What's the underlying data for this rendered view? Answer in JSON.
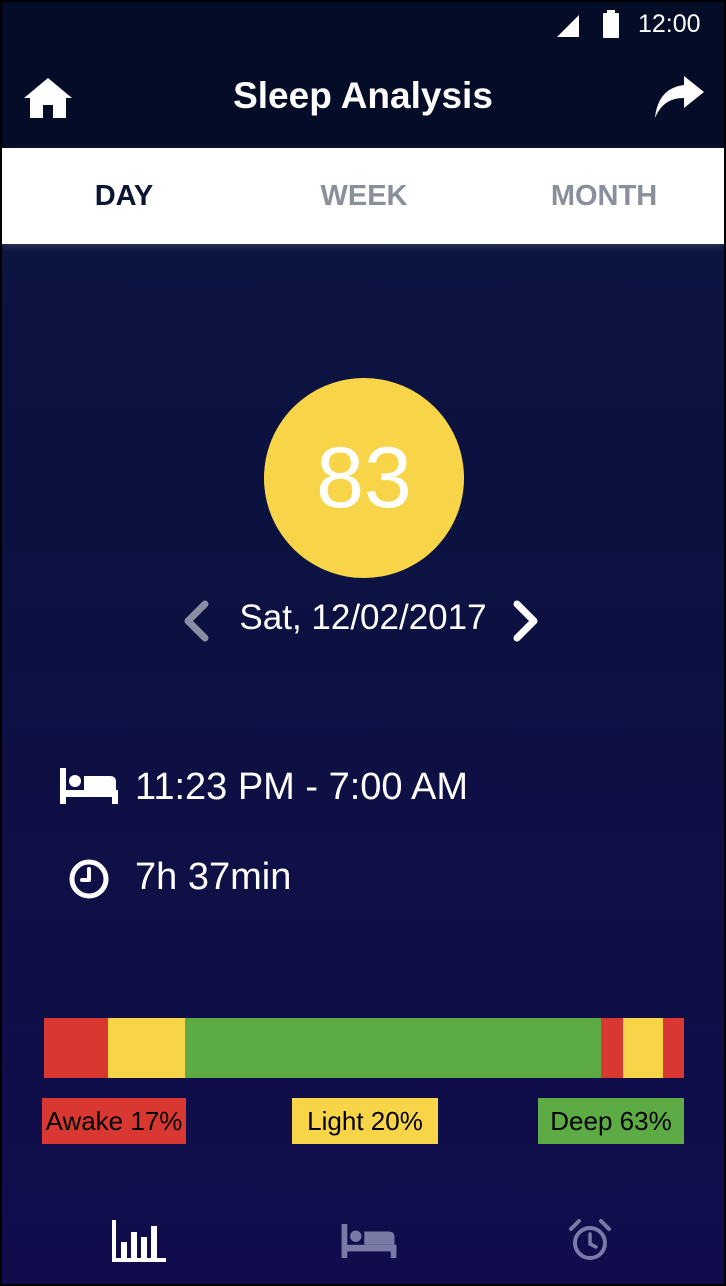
{
  "status_bar": {
    "time": "12:00"
  },
  "app_bar": {
    "title": "Sleep Analysis"
  },
  "tabs": [
    {
      "label": "DAY",
      "active": true
    },
    {
      "label": "WEEK",
      "active": false
    },
    {
      "label": "MONTH",
      "active": false
    }
  ],
  "score": {
    "value": "83",
    "color": "#f8d548"
  },
  "date_nav": {
    "date": "Sat, 12/02/2017"
  },
  "sleep_info": {
    "time_range": "11:23 PM - 7:00 AM",
    "duration": "7h 37min"
  },
  "sleep_bar": {
    "segments": [
      {
        "stage": "awake",
        "share": 0.1
      },
      {
        "stage": "light",
        "share": 0.12
      },
      {
        "stage": "deep",
        "share": 0.65
      },
      {
        "stage": "awake",
        "share": 0.035
      },
      {
        "stage": "light",
        "share": 0.0625
      },
      {
        "stage": "awake",
        "share": 0.0325
      }
    ],
    "colors": {
      "awake": "#d93832",
      "light": "#f8d548",
      "deep": "#5cab45"
    }
  },
  "legend": {
    "awake": "Awake 17%",
    "light": "Light 20%",
    "deep": "Deep 63%"
  },
  "bottom_nav": {
    "items": [
      {
        "icon": "bar-chart-icon",
        "active": true
      },
      {
        "icon": "bed-icon",
        "active": false
      },
      {
        "icon": "alarm-icon",
        "active": false
      }
    ]
  }
}
